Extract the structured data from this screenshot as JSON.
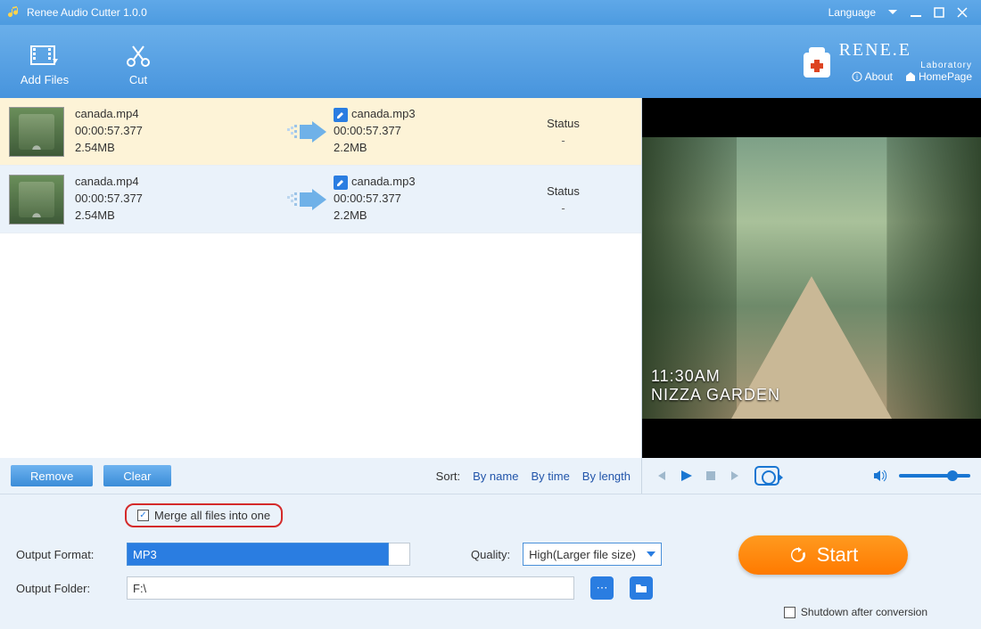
{
  "title": "Renee Audio Cutter 1.0.0",
  "header": {
    "language": "Language",
    "logo": "RENE.E",
    "logo_sub": "Laboratory",
    "about": "About",
    "homepage": "HomePage"
  },
  "toolbar": {
    "add_files": "Add Files",
    "cut": "Cut"
  },
  "files": [
    {
      "src_name": "canada.mp4",
      "src_dur": "00:00:57.377",
      "src_size": "2.54MB",
      "out_name": "canada.mp3",
      "out_dur": "00:00:57.377",
      "out_size": "2.2MB",
      "status_label": "Status",
      "status_val": "-"
    },
    {
      "src_name": "canada.mp4",
      "src_dur": "00:00:57.377",
      "src_size": "2.54MB",
      "out_name": "canada.mp3",
      "out_dur": "00:00:57.377",
      "out_size": "2.2MB",
      "status_label": "Status",
      "status_val": "-"
    }
  ],
  "listfooter": {
    "remove": "Remove",
    "clear": "Clear",
    "sort_label": "Sort:",
    "by_name": "By name",
    "by_time": "By time",
    "by_length": "By length"
  },
  "preview": {
    "time": "11:30AM",
    "place": "NIZZA GARDEN"
  },
  "bottom": {
    "merge": "Merge all files into one",
    "format_label": "Output Format:",
    "format_value": "MP3",
    "quality_label": "Quality:",
    "quality_value": "High(Larger file size)",
    "folder_label": "Output Folder:",
    "folder_value": "F:\\",
    "start": "Start",
    "shutdown": "Shutdown after conversion"
  }
}
